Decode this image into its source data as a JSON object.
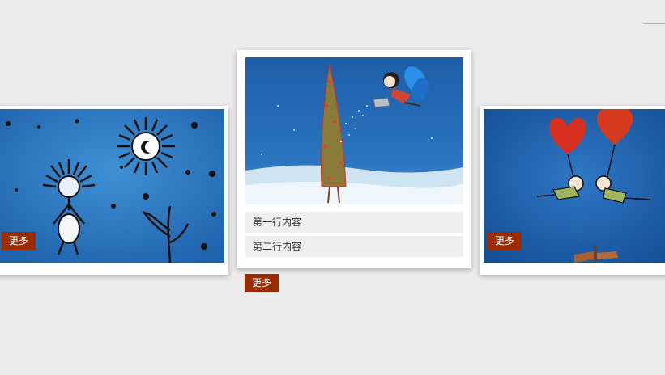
{
  "slides": {
    "left": {
      "more_label": "更多"
    },
    "center": {
      "row1": "第一行内容",
      "row2": "第二行内容",
      "more_label": "更多"
    },
    "right": {
      "more_label": "更多"
    }
  },
  "colors": {
    "accent": "#9c2b00",
    "background": "#ececec",
    "card": "#ffffff",
    "row": "#efefef"
  }
}
